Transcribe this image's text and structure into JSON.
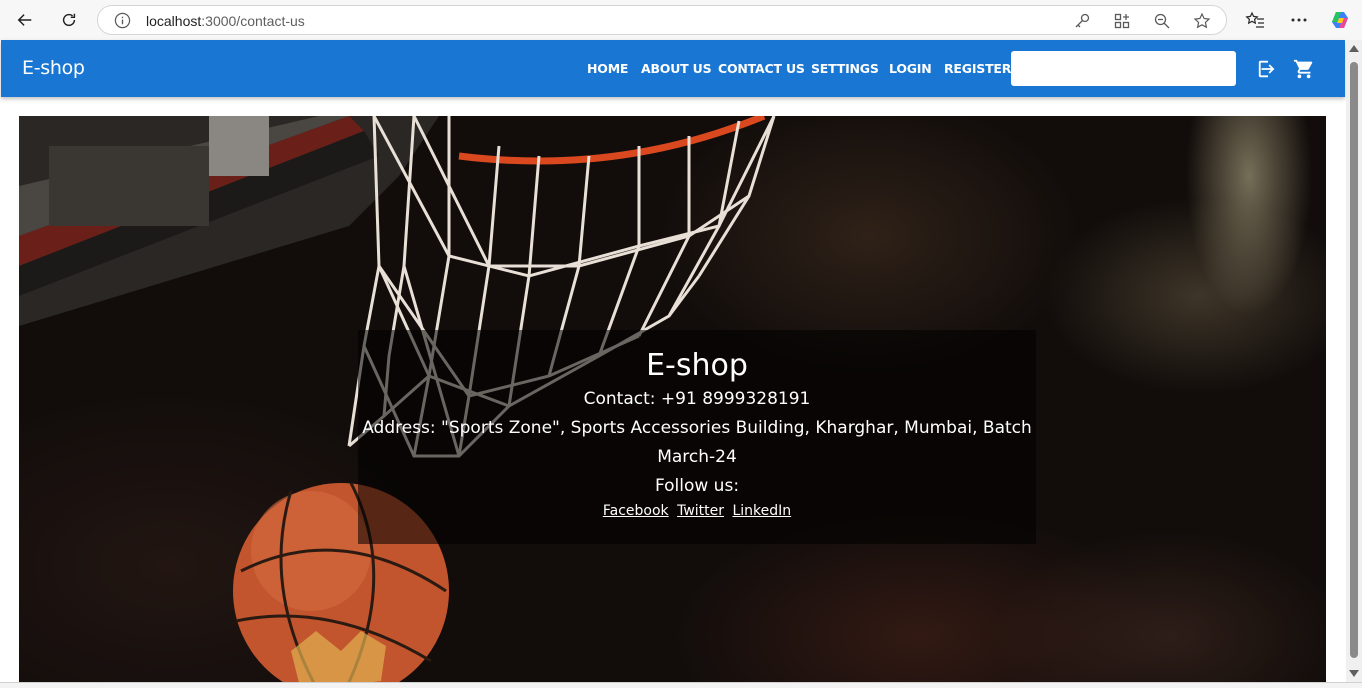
{
  "browser": {
    "url_host": "localhost",
    "url_path": ":3000/contact-us"
  },
  "appbar": {
    "brand": "E-shop",
    "color": "#1976d2",
    "nav": [
      "HOME",
      "ABOUT US",
      "CONTACT US",
      "SETTINGS",
      "LOGIN",
      "REGISTER"
    ],
    "search_value": "",
    "icons": [
      "login-icon",
      "cart-icon"
    ]
  },
  "hero": {
    "title": "E-shop",
    "contact": "Contact: +91 8999328191",
    "address_line1": "Address: \"Sports Zone\", Sports Accessories Building, Kharghar, Mumbai, Batch",
    "address_line2": "March-24",
    "follow": "Follow us:",
    "links": [
      "Facebook",
      "Twitter",
      "LinkedIn"
    ]
  }
}
